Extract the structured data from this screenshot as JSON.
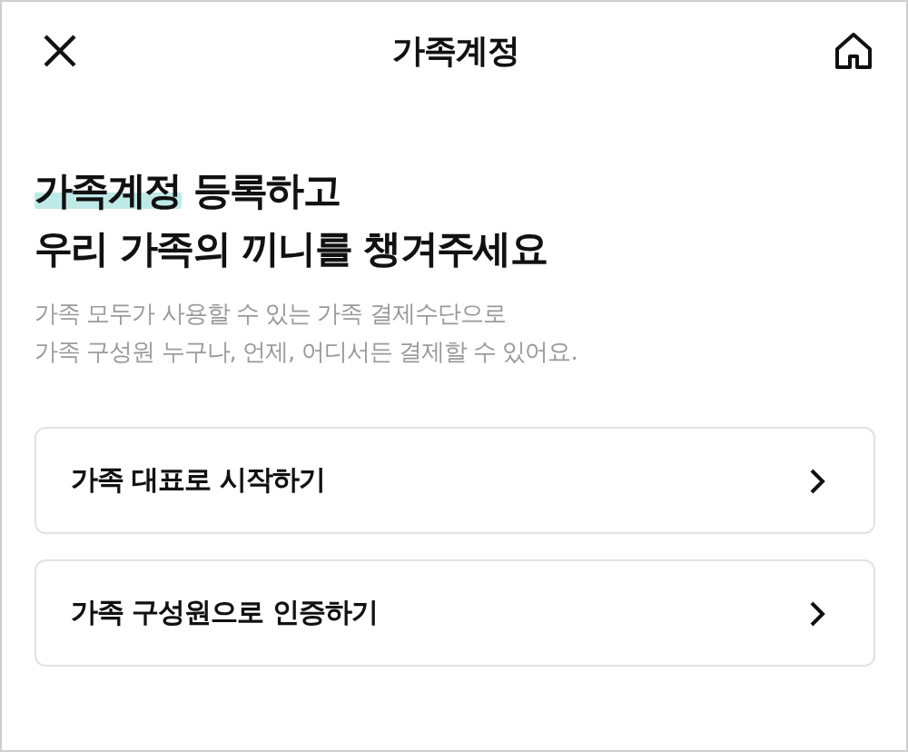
{
  "header": {
    "title": "가족계정"
  },
  "headline": {
    "lines": [
      [
        {
          "text": "가족계정",
          "highlighted": true
        },
        {
          "text": " 등록하고",
          "highlighted": false
        }
      ],
      [
        {
          "text": "우리 가족의 끼니를 챙겨주세요",
          "highlighted": false
        }
      ]
    ]
  },
  "description": [
    "가족 모두가 사용할 수 있는 가족 결제수단으로",
    "가족 구성원 누구나, 언제, 어디서든 결제할 수 있어요."
  ],
  "options": [
    {
      "label": "가족 대표로 시작하기"
    },
    {
      "label": "가족 구성원으로 인증하기"
    }
  ]
}
